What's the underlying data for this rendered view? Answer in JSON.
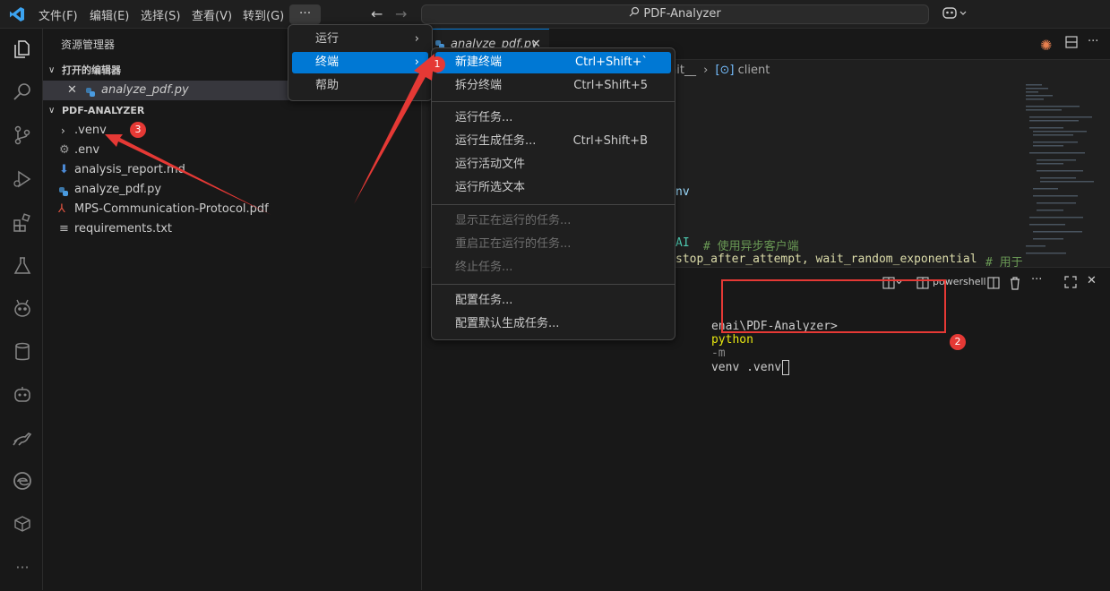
{
  "titlebar": {
    "menus": [
      "文件(F)",
      "编辑(E)",
      "选择(S)",
      "查看(V)",
      "转到(G)"
    ],
    "more": "···",
    "search": "PDF-Analyzer"
  },
  "sidebar": {
    "title": "资源管理器",
    "open_editors": "打开的编辑器",
    "open_file": "analyze_pdf.py",
    "project": "PDF-ANALYZER",
    "files": [
      ".venv",
      ".env",
      "analysis_report.md",
      "analyze_pdf.py",
      "MPS-Communication-Protocol.pdf",
      "requirements.txt"
    ]
  },
  "editor": {
    "tab": "analyze_pdf.py",
    "breadcrumb_part": "nit__",
    "breadcrumb_symbol": "client",
    "code_line1": "nv",
    "code_line2_kw": "AI",
    "code_line2_comment": "# 使用异步客户端",
    "code_line3": "stop_after_attempt, wait_random_exponential",
    "code_line3_comment": "# 用于"
  },
  "terminal": {
    "shell": "powershell",
    "prompt": "enai\\PDF-Analyzer>",
    "cmd": "python",
    "flag": "-m",
    "args": "venv .venv"
  },
  "context_menu": {
    "items": [
      "运行",
      "终端",
      "帮助"
    ]
  },
  "terminal_menu": {
    "items": [
      {
        "label": "新建终端",
        "kb": "Ctrl+Shift+`"
      },
      {
        "label": "拆分终端",
        "kb": "Ctrl+Shift+5"
      },
      {
        "label": "运行任务...",
        "kb": ""
      },
      {
        "label": "运行生成任务...",
        "kb": "Ctrl+Shift+B"
      },
      {
        "label": "运行活动文件",
        "kb": ""
      },
      {
        "label": "运行所选文本",
        "kb": ""
      },
      {
        "label": "显示正在运行的任务...",
        "kb": ""
      },
      {
        "label": "重启正在运行的任务...",
        "kb": ""
      },
      {
        "label": "终止任务...",
        "kb": ""
      },
      {
        "label": "配置任务...",
        "kb": ""
      },
      {
        "label": "配置默认生成任务...",
        "kb": ""
      }
    ]
  },
  "annotations": {
    "badge1": "1",
    "badge2": "2",
    "badge3": "3"
  },
  "colors": {
    "accent": "#0078d4",
    "annotation": "#e53935",
    "menu_bg": "#1f1f1f"
  }
}
